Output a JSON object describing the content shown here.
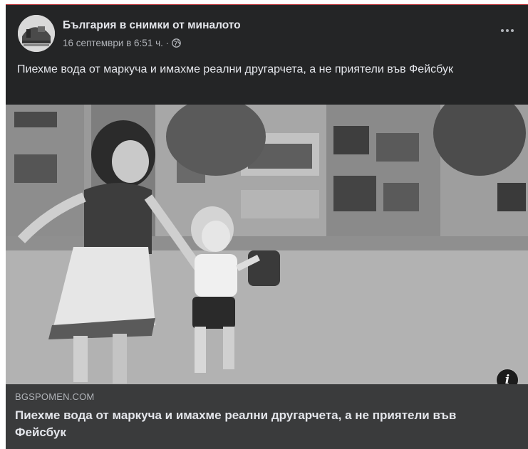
{
  "post": {
    "page_name": "България в снимки от миналото",
    "timestamp": "16 септември в 6:51 ч. · ",
    "privacy_icon": "globe-icon",
    "more_icon": "more-options-icon",
    "text": "Пиехме вода от маркуча и имахме реални другарчета, а не приятели във Фейсбук"
  },
  "image": {
    "info_label": "i"
  },
  "link_preview": {
    "domain": "BGSPOMEN.COM",
    "title": "Пиехме вода от маркуча и имахме реални другарчета, а не приятели във Фейсбук"
  },
  "colors": {
    "card_bg": "#242526",
    "link_bg": "#3a3b3c",
    "primary_text": "#e4e6eb",
    "secondary_text": "#b0b3b8"
  }
}
